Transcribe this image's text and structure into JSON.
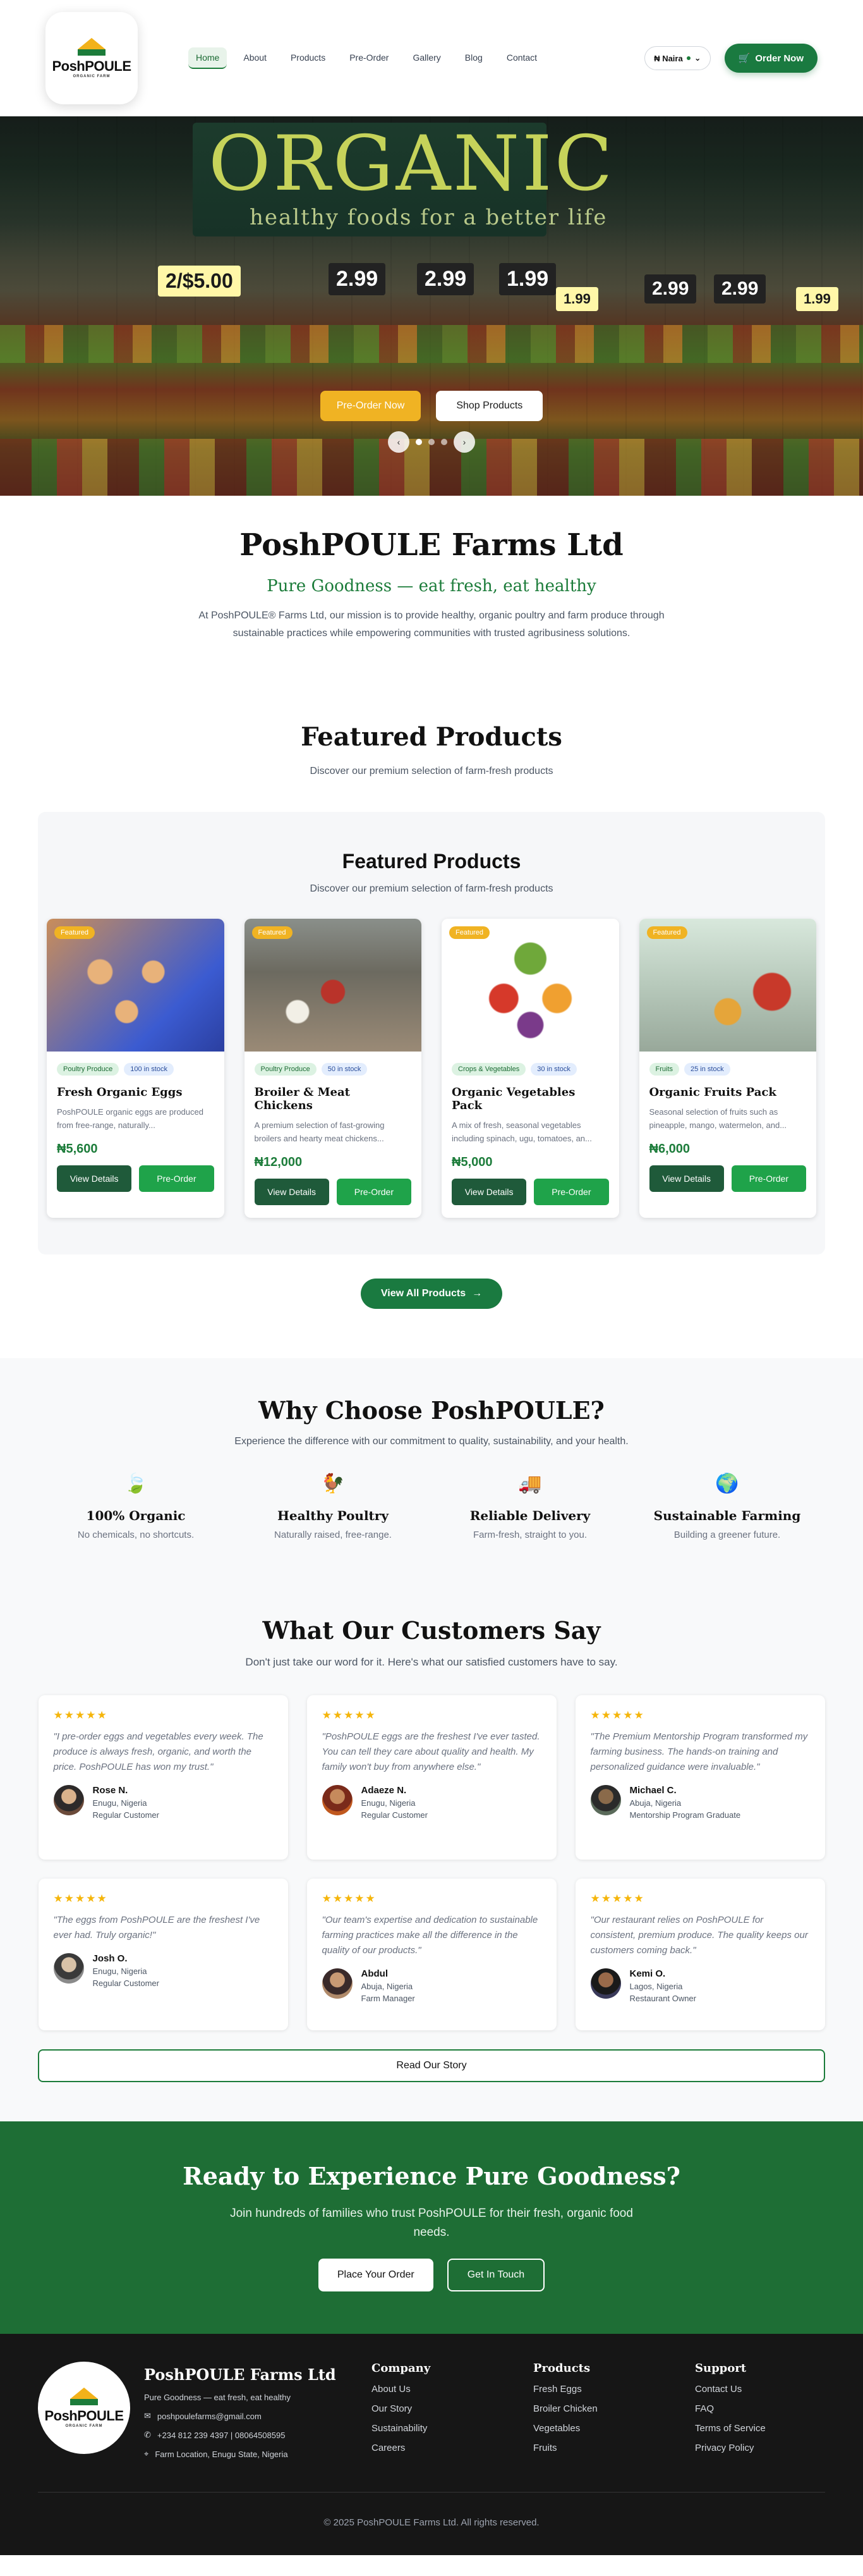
{
  "header": {
    "logo_text": "PoshPOULE",
    "logo_sub": "ORGANIC FARM",
    "nav": [
      "Home",
      "About",
      "Products",
      "Pre-Order",
      "Gallery",
      "Blog",
      "Contact"
    ],
    "currency": "₦ Naira",
    "order_label": "Order Now"
  },
  "hero": {
    "sign_title": "ORGANIC",
    "sign_sub": "healthy foods for a better life",
    "primary_label": "Pre-Order Now",
    "secondary_label": "Shop Products",
    "prices": [
      "2/$5.00",
      "2.99",
      "2.99",
      "1.99",
      "1.99",
      "2.99",
      "2.99",
      "1.99"
    ]
  },
  "about": {
    "title": "PoshPOULE Farms Ltd",
    "tagline": "Pure Goodness — eat fresh, eat healthy",
    "text": "At PoshPOULE® Farms Ltd, our mission is to provide healthy, organic poultry and farm produce through sustainable practices while empowering communities with trusted agribusiness solutions."
  },
  "featured": {
    "title": "Featured Products",
    "subtitle": "Discover our premium selection of farm-fresh products",
    "inner_title": "Featured Products",
    "inner_subtitle": "Discover our premium selection of farm-fresh products",
    "badge": "Featured",
    "view_label": "View Details",
    "preorder_label": "Pre-Order",
    "view_all_label": "View All Products",
    "products": [
      {
        "category": "Poultry Produce",
        "stock": "100 in stock",
        "name": "Fresh Organic Eggs",
        "desc": "PoshPOULE organic eggs are produced from free-range, naturally...",
        "price": "₦5,600"
      },
      {
        "category": "Poultry Produce",
        "stock": "50 in stock",
        "name": "Broiler & Meat Chickens",
        "desc": "A premium selection of fast-growing broilers and hearty meat chickens...",
        "price": "₦12,000"
      },
      {
        "category": "Crops & Vegetables",
        "stock": "30 in stock",
        "name": "Organic Vegetables Pack",
        "desc": "A mix of fresh, seasonal vegetables including spinach, ugu, tomatoes, an...",
        "price": "₦5,000"
      },
      {
        "category": "Fruits",
        "stock": "25 in stock",
        "name": "Organic Fruits Pack",
        "desc": "Seasonal selection of fruits such as pineapple, mango, watermelon, and...",
        "price": "₦6,000"
      }
    ]
  },
  "why": {
    "title": "Why Choose PoshPOULE?",
    "subtitle": "Experience the difference with our commitment to quality, sustainability, and your health.",
    "features": [
      {
        "icon": "leaf-icon",
        "glyph": "🍃",
        "title": "100% Organic",
        "text": "No chemicals, no shortcuts."
      },
      {
        "icon": "chicken-icon",
        "glyph": "🐓",
        "title": "Healthy Poultry",
        "text": "Naturally raised, free-range."
      },
      {
        "icon": "truck-icon",
        "glyph": "🚚",
        "title": "Reliable Delivery",
        "text": "Farm-fresh, straight to you."
      },
      {
        "icon": "globe-icon",
        "glyph": "🌍",
        "title": "Sustainable Farming",
        "text": "Building a greener future."
      }
    ]
  },
  "testimonials": {
    "title": "What Our Customers Say",
    "subtitle": "Don't just take our word for it. Here's what our satisfied customers have to say.",
    "stars": "★★★★★",
    "items": [
      {
        "quote": "\"I pre-order eggs and vegetables every week. The produce is always fresh, organic, and worth the price. PoshPOULE has won my trust.\"",
        "name": "Rose N.",
        "location": "Enugu, Nigeria",
        "role": "Regular Customer"
      },
      {
        "quote": "\"PoshPOULE eggs are the freshest I've ever tasted. You can tell they care about quality and health. My family won't buy from anywhere else.\"",
        "name": "Adaeze N.",
        "location": "Enugu, Nigeria",
        "role": "Regular Customer"
      },
      {
        "quote": "\"The Premium Mentorship Program transformed my farming business. The hands-on training and personalized guidance were invaluable.\"",
        "name": "Michael C.",
        "location": "Abuja, Nigeria",
        "role": "Mentorship Program Graduate"
      },
      {
        "quote": "\"The eggs from PoshPOULE are the freshest I've ever had. Truly organic!\"",
        "name": "Josh O.",
        "location": "Enugu, Nigeria",
        "role": "Regular Customer"
      },
      {
        "quote": "\"Our team's expertise and dedication to sustainable farming practices make all the difference in the quality of our products.\"",
        "name": "Abdul",
        "location": "Abuja, Nigeria",
        "role": "Farm Manager"
      },
      {
        "quote": "\"Our restaurant relies on PoshPOULE for consistent, premium produce. The quality keeps our customers coming back.\"",
        "name": "Kemi O.",
        "location": "Lagos, Nigeria",
        "role": "Restaurant Owner"
      }
    ],
    "read_story_label": "Read Our Story"
  },
  "cta": {
    "title": "Ready to Experience Pure Goodness?",
    "text": "Join hundreds of families who trust PoshPOULE for their fresh, organic food needs.",
    "primary_label": "Place Your Order",
    "secondary_label": "Get In Touch"
  },
  "footer": {
    "brand": "PoshPOULE Farms Ltd",
    "tagline": "Pure Goodness — eat fresh, eat healthy",
    "email": "poshpoulefarms@gmail.com",
    "phone": "+234 812 239 4397 | 08064508595",
    "address": "Farm Location, Enugu State, Nigeria",
    "columns": [
      {
        "title": "Company",
        "links": [
          "About Us",
          "Our Story",
          "Sustainability",
          "Careers"
        ]
      },
      {
        "title": "Products",
        "links": [
          "Fresh Eggs",
          "Broiler Chicken",
          "Vegetables",
          "Fruits"
        ]
      },
      {
        "title": "Support",
        "links": [
          "Contact Us",
          "FAQ",
          "Terms of Service",
          "Privacy Policy"
        ]
      }
    ],
    "copyright": "© 2025 PoshPOULE Farms Ltd. All rights reserved."
  },
  "colors": {
    "brand_green": "#1a7a40",
    "gold": "#f0b323",
    "dark_footer": "#161616"
  }
}
